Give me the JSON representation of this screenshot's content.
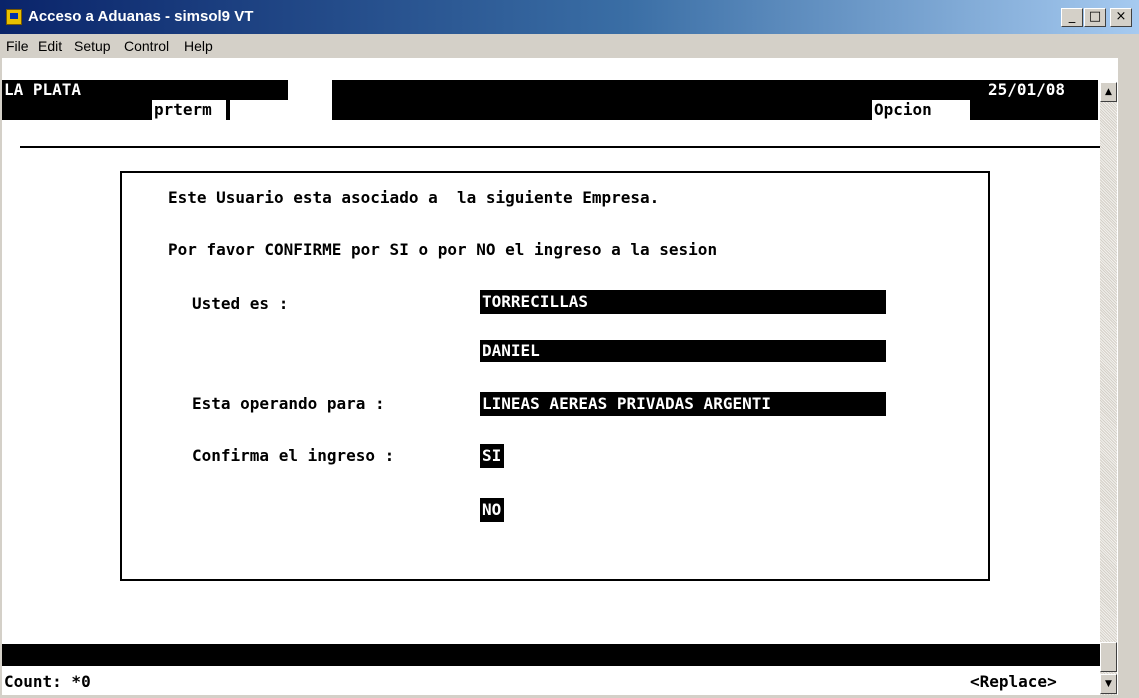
{
  "window": {
    "title": "Acceso a Aduanas - simsol9 VT",
    "minimize": "_",
    "maximize": "□",
    "close": "×"
  },
  "menu": {
    "file": "File",
    "edit": "Edit",
    "setup": "Setup",
    "control": "Control",
    "help": "Help"
  },
  "header": {
    "location": "LA PLATA",
    "program": "prterm",
    "option_label": "Opcion",
    "date": "25/01/08"
  },
  "dialog": {
    "line1": "Este Usuario esta asociado a  la siguiente Empresa.",
    "line2": "Por favor CONFIRME por SI o por NO el ingreso a la sesion",
    "usted_label": "Usted es :",
    "surname": "TORRECILLAS",
    "first_name": "DANIEL",
    "operando_label": "Esta operando para :",
    "company": "LINEAS AEREAS PRIVADAS ARGENTI",
    "confirma_label": "Confirma el ingreso :",
    "option_si": "SI",
    "option_no": "NO"
  },
  "status": {
    "count": "Count: *0",
    "mode": "<Replace>"
  },
  "scrollbar": {
    "up": "▲",
    "down": "▼"
  },
  "colors": {
    "titlebar_start": "#0a246a",
    "titlebar_end": "#a6caf0",
    "terminal_bg": "#ffffff",
    "terminal_text": "#000000",
    "chrome": "#d4d0c8"
  }
}
